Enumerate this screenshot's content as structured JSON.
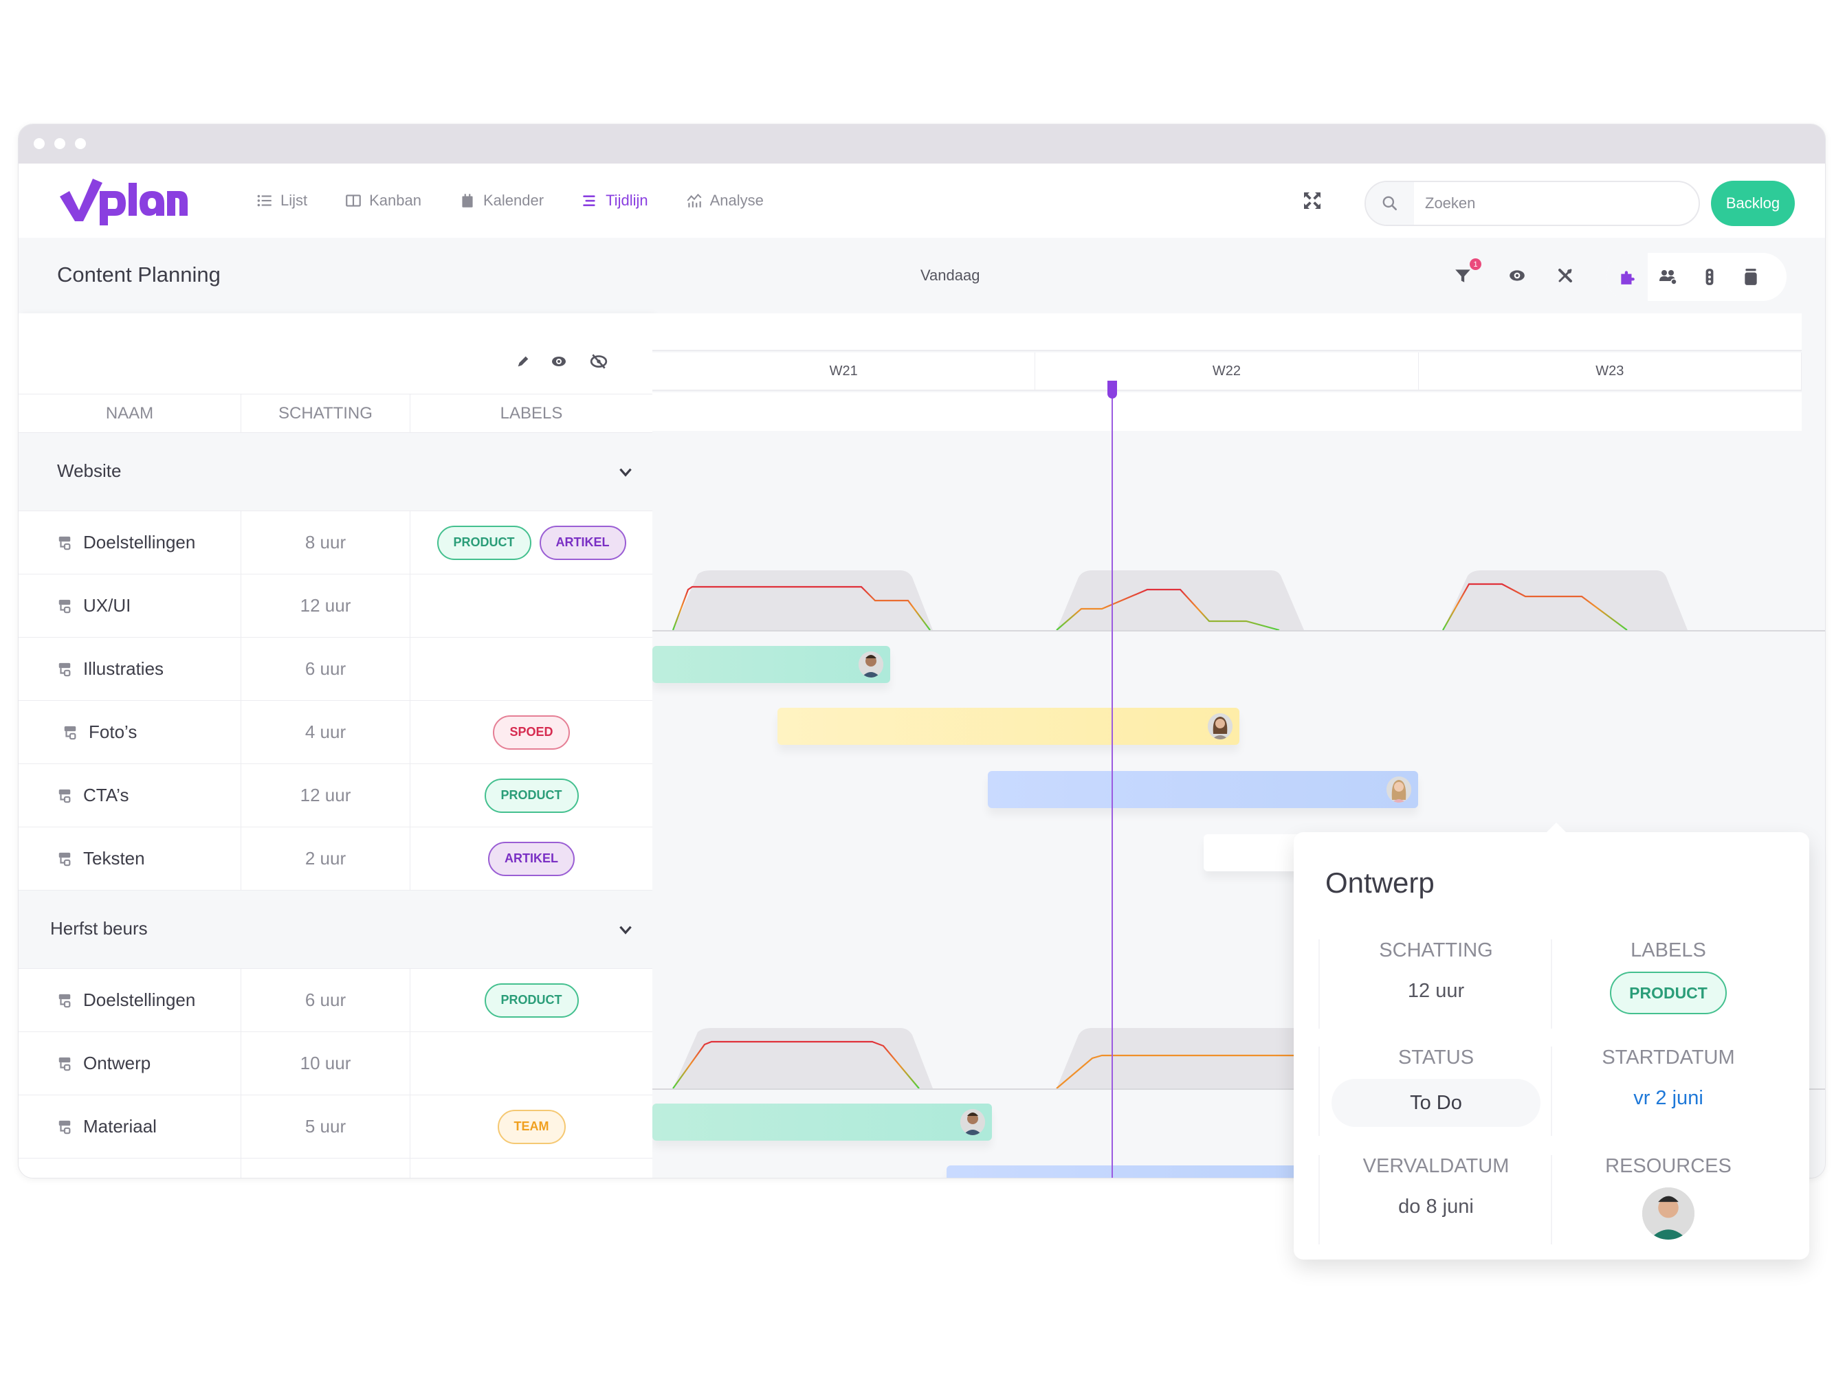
{
  "app": {
    "name": "vplan"
  },
  "nav": [
    {
      "label": "Lijst",
      "icon": "list-icon",
      "active": false
    },
    {
      "label": "Kanban",
      "icon": "kanban-icon",
      "active": false
    },
    {
      "label": "Kalender",
      "icon": "calendar-icon",
      "active": false
    },
    {
      "label": "Tijdlijn",
      "icon": "timeline-icon",
      "active": true
    },
    {
      "label": "Analyse",
      "icon": "analytics-icon",
      "active": false
    }
  ],
  "search": {
    "placeholder": "Zoeken",
    "value": ""
  },
  "backlog_label": "Backlog",
  "page_title": "Content Planning",
  "today_label": "Vandaag",
  "filter_badge": "1",
  "colors": {
    "accent": "#8a3fe0",
    "backlog": "#2ecb98",
    "product": "#2a9d78",
    "artikel": "#7a2fc4",
    "spoed": "#d62b50",
    "team": "#f0a020",
    "link": "#1e78d8"
  },
  "table": {
    "columns": [
      "NAAM",
      "SCHATTING",
      "LABELS"
    ],
    "groups": [
      {
        "name": "Website",
        "rows": [
          {
            "name": "Doelstellingen",
            "estimate": "8 uur",
            "labels": [
              "PRODUCT",
              "ARTIKEL"
            ]
          },
          {
            "name": "UX/UI",
            "estimate": "12 uur",
            "labels": []
          },
          {
            "name": "Illustraties",
            "estimate": "6 uur",
            "labels": []
          },
          {
            "name": "Foto’s",
            "estimate": "4 uur",
            "labels": [
              "SPOED"
            ]
          },
          {
            "name": "CTA’s",
            "estimate": "12 uur",
            "labels": [
              "PRODUCT"
            ]
          },
          {
            "name": "Teksten",
            "estimate": "2 uur",
            "labels": [
              "ARTIKEL"
            ]
          }
        ]
      },
      {
        "name": "Herfst beurs",
        "rows": [
          {
            "name": "Doelstellingen",
            "estimate": "6 uur",
            "labels": [
              "PRODUCT"
            ]
          },
          {
            "name": "Ontwerp",
            "estimate": "10 uur",
            "labels": []
          },
          {
            "name": "Materiaal",
            "estimate": "5 uur",
            "labels": [
              "TEAM"
            ]
          }
        ]
      }
    ]
  },
  "timeline": {
    "weeks": [
      "W21",
      "W22",
      "W23"
    ]
  },
  "popup": {
    "title": "Ontwerp",
    "estimate_label": "SCHATTING",
    "estimate": "12 uur",
    "labels_label": "LABELS",
    "label": "PRODUCT",
    "status_label": "STATUS",
    "status": "To Do",
    "start_label": "STARTDATUM",
    "start": "vr 2 juni",
    "due_label": "VERVALDATUM",
    "due": "do 8 juni",
    "resources_label": "RESOURCES"
  }
}
